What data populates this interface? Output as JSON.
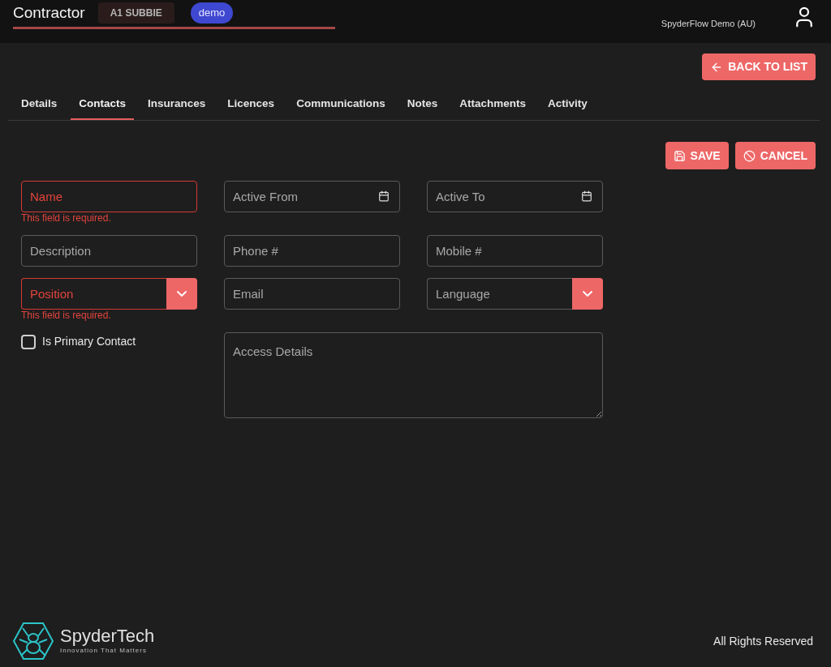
{
  "header": {
    "title": "Contractor",
    "badge": "A1 SUBBIE",
    "tag": "demo",
    "account": "SpyderFlow Demo (AU)"
  },
  "back_button": "BACK TO LIST",
  "tabs": [
    {
      "label": "Details",
      "selected": false
    },
    {
      "label": "Contacts",
      "selected": true
    },
    {
      "label": "Insurances",
      "selected": false
    },
    {
      "label": "Licences",
      "selected": false
    },
    {
      "label": "Communications",
      "selected": false
    },
    {
      "label": "Notes",
      "selected": false
    },
    {
      "label": "Attachments",
      "selected": false
    },
    {
      "label": "Activity",
      "selected": false
    }
  ],
  "actions": [
    {
      "kind": "save",
      "label": "SAVE"
    },
    {
      "kind": "cancel",
      "label": "CANCEL"
    }
  ],
  "fields": [
    {
      "kind": "text",
      "placeholder": "Name",
      "error": "This field is required."
    },
    {
      "kind": "date",
      "placeholder": "Active From"
    },
    {
      "kind": "date",
      "placeholder": "Active To"
    },
    {
      "kind": "text",
      "placeholder": "Description"
    },
    {
      "kind": "text",
      "placeholder": "Phone #"
    },
    {
      "kind": "text",
      "placeholder": "Mobile #"
    },
    {
      "kind": "select",
      "placeholder": "Position",
      "error": "This field is required."
    },
    {
      "kind": "text",
      "placeholder": "Email"
    },
    {
      "kind": "select",
      "placeholder": "Language"
    },
    {
      "kind": "checkbox",
      "label": "Is Primary Contact",
      "checked": false
    },
    {
      "kind": "textarea",
      "placeholder": "Access Details"
    }
  ],
  "footer": {
    "brand": "SpyderTech",
    "tagline": "Innovation That Matters",
    "rights": "All Rights Reserved"
  }
}
